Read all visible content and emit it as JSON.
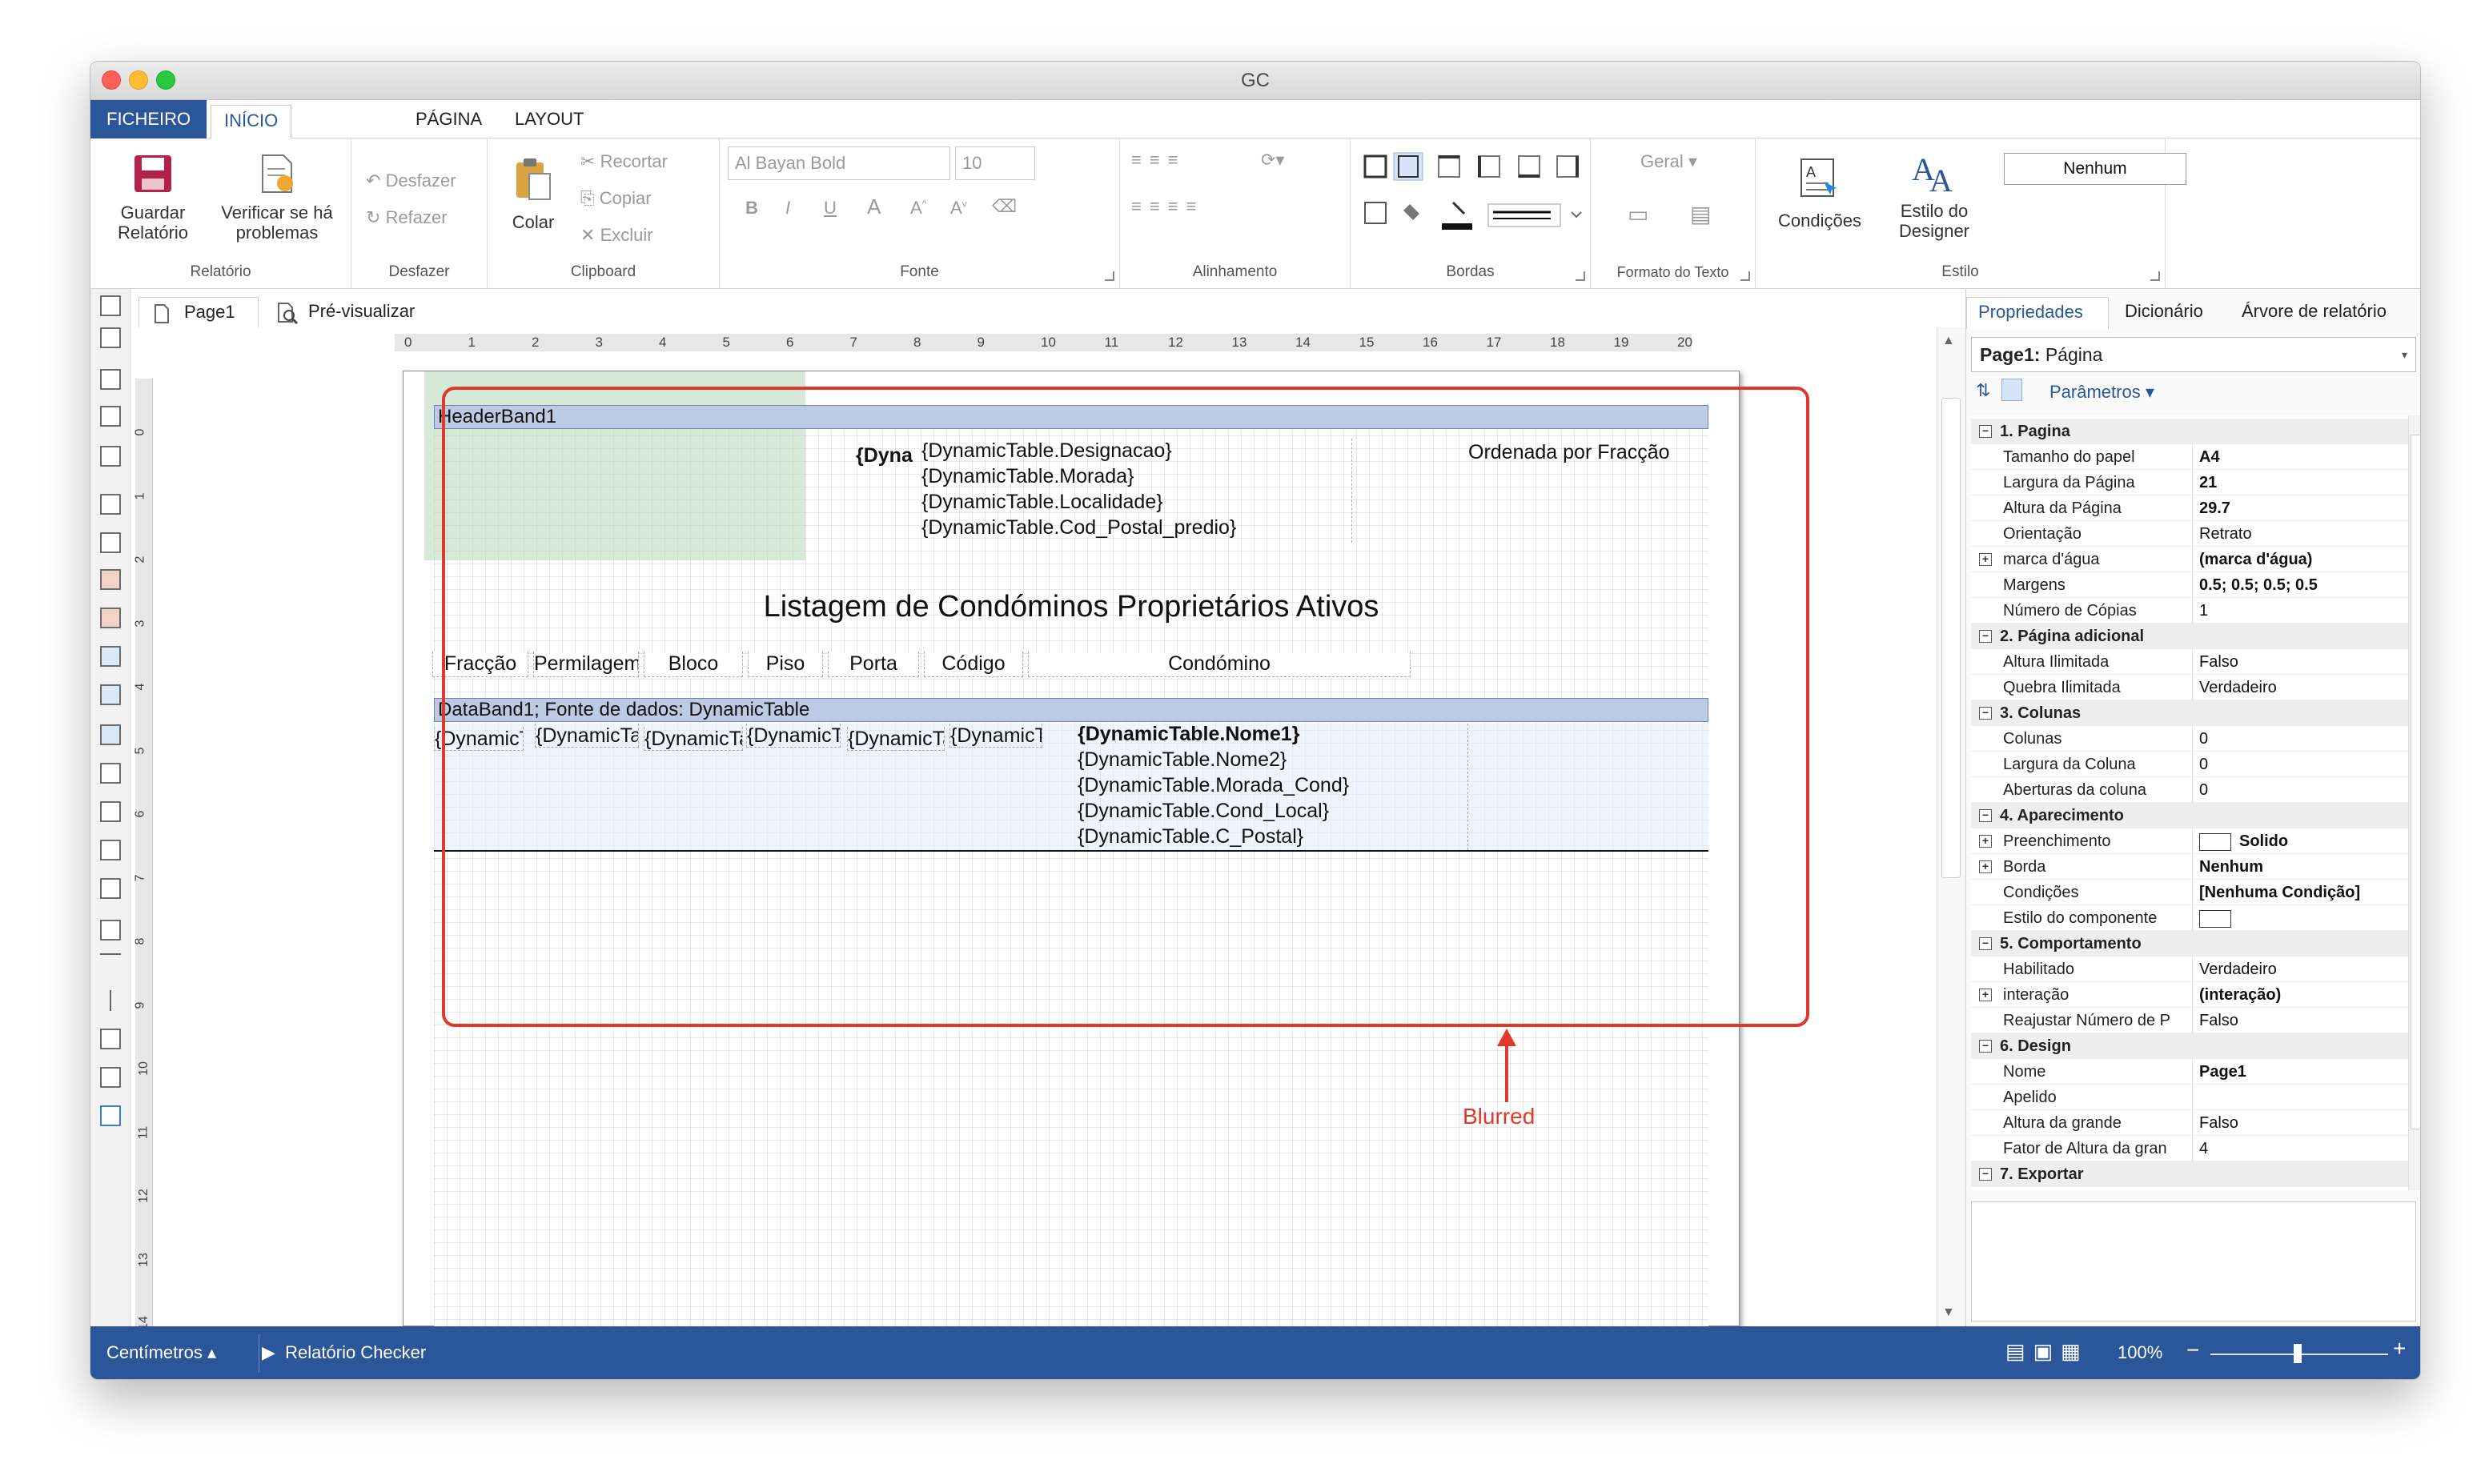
{
  "window": {
    "title": "GC"
  },
  "menu": {
    "tabs": [
      "FICHEIRO",
      "INÍCIO",
      "PÁGINA",
      "LAYOUT"
    ]
  },
  "ribbon": {
    "relatorio": {
      "label": "Relatório",
      "save": "Guardar Relatório",
      "check": "Verificar se há problemas"
    },
    "desfazer": {
      "label": "Desfazer",
      "undo": "Desfazer",
      "redo": "Refazer"
    },
    "clipboard": {
      "label": "Clipboard",
      "paste": "Colar",
      "cut": "Recortar",
      "copy": "Copiar",
      "delete": "Excluir"
    },
    "fonte": {
      "label": "Fonte",
      "font_name": "Al Bayan Bold",
      "font_size": "10"
    },
    "alinhamento": {
      "label": "Alinhamento"
    },
    "bordas": {
      "label": "Bordas"
    },
    "formato": {
      "label": "Formato do Texto",
      "value": "Geral"
    },
    "estilo": {
      "label": "Estilo",
      "conditions": "Condições",
      "designer_style": "Estilo do Designer",
      "style_value": "Nenhum"
    }
  },
  "doc_tabs": [
    "Page1",
    "Pré-visualizar"
  ],
  "ruler": {
    "h": [
      "0",
      "1",
      "2",
      "3",
      "4",
      "5",
      "6",
      "7",
      "8",
      "9",
      "10",
      "11",
      "12",
      "13",
      "14",
      "15",
      "16",
      "17",
      "18",
      "19",
      "20"
    ],
    "v": [
      "0",
      "1",
      "2",
      "3",
      "4",
      "5",
      "6",
      "7",
      "8",
      "9",
      "10",
      "11",
      "12",
      "13",
      "14"
    ]
  },
  "report": {
    "header_band": "HeaderBand1",
    "header_short": "{Dyna",
    "header_fields": [
      "{DynamicTable.Designacao}",
      "{DynamicTable.Morada}",
      "{DynamicTable.Localidade}",
      "{DynamicTable.Cod_Postal_predio}"
    ],
    "ordered": "Ordenada por Fracção",
    "title": "Listagem de Condóminos Proprietários Ativos",
    "columns": [
      "Fracção",
      "Permilagem",
      "Bloco",
      "Piso",
      "Porta",
      "Código",
      "Condómino"
    ],
    "data_band": "DataBand1; Fonte de dados: DynamicTable",
    "data_cells": [
      "{DynamicTable.Fraccao}",
      "{DynamicTable.Permilagem}",
      "{DynamicTable.Bloco}",
      "{DynamicTable.Piso}",
      "{DynamicTable.Porta}",
      "{DynamicTable.Codigo}"
    ],
    "owner_fields": [
      "{DynamicTable.Nome1}",
      "{DynamicTable.Nome2}",
      "{DynamicTable.Morada_Cond}",
      "{DynamicTable.Cond_Local}",
      "{DynamicTable.C_Postal}"
    ]
  },
  "annotation": {
    "label": "Blurred",
    "color": "#e0392b"
  },
  "right_panel": {
    "tabs": [
      "Propriedades",
      "Dicionário",
      "Árvore de relatório"
    ],
    "selector_bold": "Page1:",
    "selector_rest": " Página",
    "params": "Parâmetros",
    "categories": [
      {
        "title": "1. Pagina",
        "rows": [
          {
            "name": "Tamanho do papel",
            "value": "A4",
            "bold": true
          },
          {
            "name": "Largura da Página",
            "value": "21",
            "bold": true
          },
          {
            "name": "Altura da Página",
            "value": "29.7",
            "bold": true
          },
          {
            "name": "Orientação",
            "value": "Retrato"
          },
          {
            "name": "marca d'água",
            "value": "(marca d'água)",
            "bold": true,
            "expand": true
          },
          {
            "name": "Margens",
            "value": "0.5; 0.5; 0.5; 0.5",
            "bold": true
          },
          {
            "name": "Número de Cópias",
            "value": "1"
          }
        ]
      },
      {
        "title": "2. Página adicional",
        "rows": [
          {
            "name": "Altura Ilimitada",
            "value": "Falso"
          },
          {
            "name": "Quebra Ilimitada",
            "value": "Verdadeiro"
          }
        ]
      },
      {
        "title": "3. Colunas",
        "rows": [
          {
            "name": "Colunas",
            "value": "0"
          },
          {
            "name": "Largura da Coluna",
            "value": "0"
          },
          {
            "name": "Aberturas da coluna",
            "value": "0"
          }
        ]
      },
      {
        "title": "4. Aparecimento",
        "rows": [
          {
            "name": "Preenchimento",
            "value": "Solido",
            "bold": true,
            "expand": true,
            "swatch": true
          },
          {
            "name": "Borda",
            "value": "Nenhum",
            "bold": true,
            "expand": true
          },
          {
            "name": "Condições",
            "value": "[Nenhuma Condição]",
            "bold": true
          },
          {
            "name": "Estilo do componente",
            "value": "",
            "swatch": true
          }
        ]
      },
      {
        "title": "5. Comportamento",
        "rows": [
          {
            "name": "Habilitado",
            "value": "Verdadeiro"
          },
          {
            "name": "interação",
            "value": "(interação)",
            "bold": true,
            "expand": true
          },
          {
            "name": "Reajustar Número de P",
            "value": "Falso"
          }
        ]
      },
      {
        "title": "6. Design",
        "rows": [
          {
            "name": "Nome",
            "value": "Page1",
            "bold": true
          },
          {
            "name": "Apelido",
            "value": ""
          },
          {
            "name": "Altura da grande",
            "value": "Falso"
          },
          {
            "name": "Fator de Altura da gran",
            "value": "4"
          }
        ]
      },
      {
        "title": "7. Exportar",
        "rows": []
      }
    ]
  },
  "status": {
    "units": "Centímetros",
    "checker": "Relatório Checker",
    "zoom": "100%"
  }
}
